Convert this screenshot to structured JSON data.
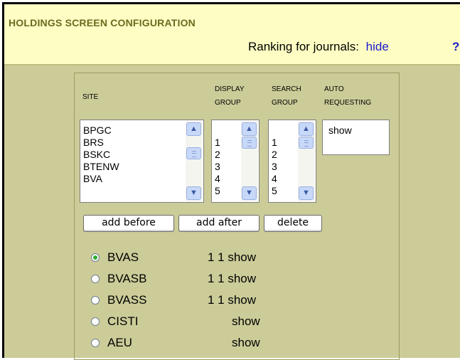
{
  "header": {
    "title": "HOLDINGS SCREEN CONFIGURATION",
    "ranking_label": "Ranking for journals:",
    "ranking_link": "hide",
    "help_link": "?"
  },
  "columns": {
    "site": "SITE",
    "display_group_1": "DISPLAY",
    "display_group_2": "GROUP",
    "search_group_1": "SEARCH",
    "search_group_2": "GROUP",
    "auto_1": "AUTO",
    "auto_2": "REQUESTING"
  },
  "site_list": [
    "BPGC",
    "BRS",
    "BSKC",
    "BTENW",
    "BVA"
  ],
  "display_group_list": [
    "1",
    "2",
    "3",
    "4",
    "5"
  ],
  "search_group_list": [
    "1",
    "2",
    "3",
    "4",
    "5"
  ],
  "auto_requesting_list": [
    "show"
  ],
  "buttons": {
    "add_before": "add before",
    "add_after": "add after",
    "delete": "delete"
  },
  "entries": [
    {
      "site": "BVAS",
      "info": "1 1 show",
      "checked": true
    },
    {
      "site": "BVASB",
      "info": "1 1 show",
      "checked": false
    },
    {
      "site": "BVASS",
      "info": "1 1 show",
      "checked": false
    },
    {
      "site": "CISTI",
      "info": "show",
      "checked": false
    },
    {
      "site": "AEU",
      "info": "show",
      "checked": false
    }
  ],
  "colors": {
    "background": "#cccc99",
    "header_bg": "#fefec4",
    "title": "#6b6b1f",
    "link": "#1a1acc",
    "radio_selected": "#30b030"
  }
}
